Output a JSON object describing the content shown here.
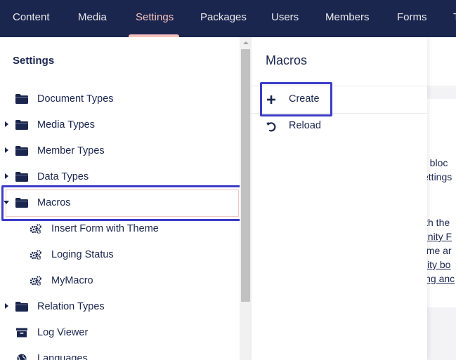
{
  "topnav": {
    "tabs": [
      {
        "label": "Content"
      },
      {
        "label": "Media"
      },
      {
        "label": "Settings"
      },
      {
        "label": "Packages"
      },
      {
        "label": "Users"
      },
      {
        "label": "Members"
      },
      {
        "label": "Forms"
      },
      {
        "label": "T"
      }
    ],
    "active_tab": "Settings"
  },
  "tree": {
    "title": "Settings",
    "items": [
      {
        "label": "Document Types",
        "expandable": false,
        "icon": "folder-icon"
      },
      {
        "label": "Media Types",
        "expandable": true,
        "icon": "folder-icon"
      },
      {
        "label": "Member Types",
        "expandable": true,
        "icon": "folder-icon"
      },
      {
        "label": "Data Types",
        "expandable": true,
        "icon": "folder-icon"
      },
      {
        "label": "Macros",
        "expandable": true,
        "expanded": true,
        "selected": true,
        "icon": "folder-icon"
      },
      {
        "label": "Insert Form with Theme",
        "child": true,
        "icon": "settings-alt-icon"
      },
      {
        "label": "Loging Status",
        "child": true,
        "icon": "settings-alt-icon"
      },
      {
        "label": "MyMacro",
        "child": true,
        "icon": "settings-alt-icon"
      },
      {
        "label": "Relation Types",
        "expandable": true,
        "icon": "folder-icon"
      },
      {
        "label": "Log Viewer",
        "expandable": false,
        "icon": "box-icon"
      },
      {
        "label": "Languages",
        "expandable": false,
        "icon": "globe-icon"
      }
    ]
  },
  "flyout": {
    "title": "Macros",
    "actions": [
      {
        "label": "Create",
        "icon": "add-icon"
      },
      {
        "label": "Reload",
        "icon": "reload-icon"
      }
    ]
  },
  "background": {
    "header_fragment": "nent",
    "lines": [
      {
        "text": "g bloc",
        "link": false
      },
      {
        "text": "ettings",
        "link": false
      },
      {
        "text": "ith the",
        "link": false
      },
      {
        "text": "unity F",
        "link": true
      },
      {
        "text": "ome ar",
        "link": false
      },
      {
        "text": "vity bo",
        "link": true
      },
      {
        "text": "ing anc",
        "link": true
      }
    ]
  },
  "colors": {
    "nav_bg": "#1b264f",
    "nav_active": "#f5c1bc",
    "highlight": "#3c3cc8",
    "text": "#1b264f"
  }
}
